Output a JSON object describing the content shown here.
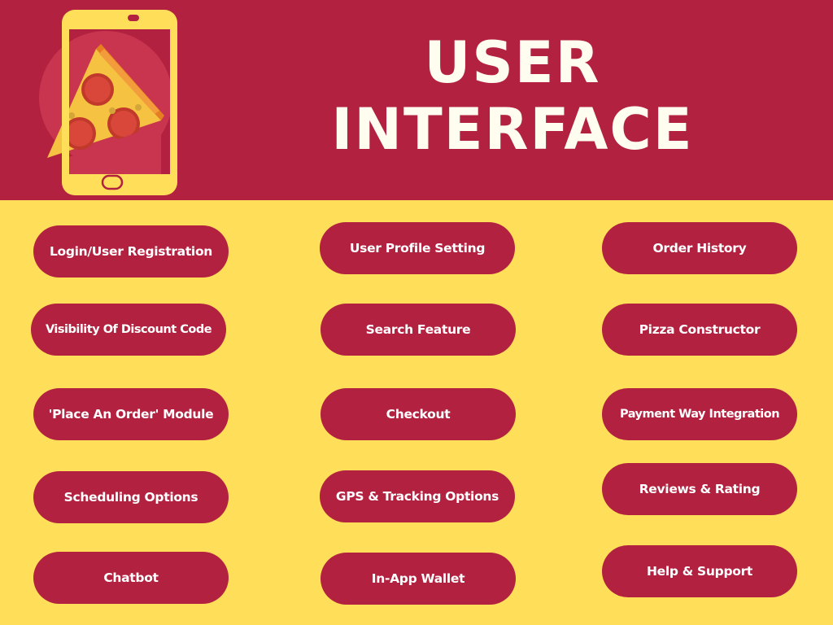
{
  "colors": {
    "primary": "#B22240",
    "background": "#FFDE59",
    "title_text": "#FFFDF0",
    "pill_text": "#FFFFFF",
    "phone": "#FFDE59",
    "circle": "#C9344F"
  },
  "header": {
    "title_line1": "USER",
    "title_line2": "INTERFACE",
    "illustration": "phone-with-pizza-slice-icon"
  },
  "features": {
    "column1": [
      "Login/User Registration",
      "Visibility Of Discount Code",
      "'Place An Order' Module",
      "Scheduling Options",
      "Chatbot"
    ],
    "column2": [
      "User Profile Setting",
      "Search Feature",
      "Checkout",
      "GPS & Tracking Options",
      "In-App Wallet"
    ],
    "column3": [
      "Order History",
      "Pizza Constructor",
      "Payment Way Integration",
      "Reviews & Rating",
      "Help & Support"
    ]
  }
}
